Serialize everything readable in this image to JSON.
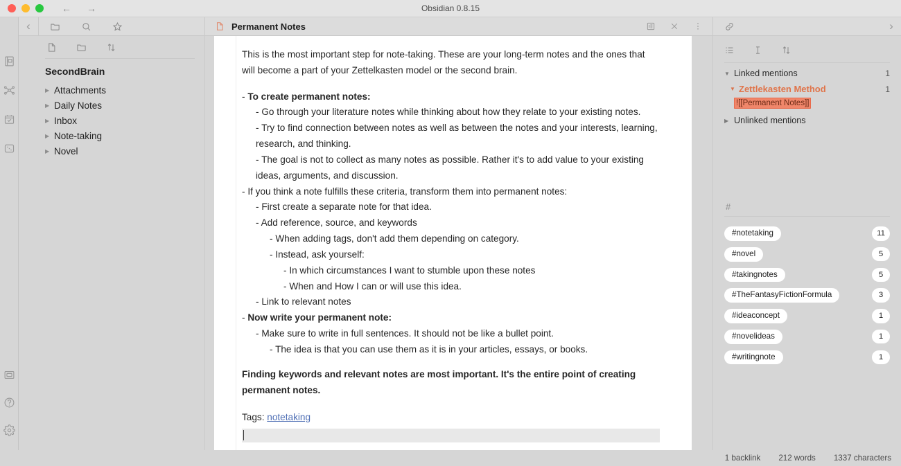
{
  "window": {
    "title": "Obsidian 0.8.15",
    "traffic_lights": [
      "close",
      "minimize",
      "maximize"
    ],
    "back_arrow": "←",
    "forward_arrow": "→"
  },
  "ribbon": {
    "items": [
      {
        "name": "open-vault-icon",
        "label": "Open vault"
      },
      {
        "name": "graph-view-icon",
        "label": "Open graph view"
      },
      {
        "name": "daily-note-icon",
        "label": "Open today's daily note"
      },
      {
        "name": "random-note-icon",
        "label": "Open random note"
      }
    ],
    "bottom_items": [
      {
        "name": "slides-icon",
        "label": "Start presentation"
      },
      {
        "name": "help-icon",
        "label": "Help"
      },
      {
        "name": "settings-icon",
        "label": "Settings"
      }
    ]
  },
  "left_sidebar": {
    "collapse_label": "‹",
    "tabs": [
      {
        "name": "file-explorer-tab",
        "icon": "folder-icon"
      },
      {
        "name": "search-tab",
        "icon": "search-icon"
      },
      {
        "name": "starred-tab",
        "icon": "star-icon"
      }
    ],
    "toolbar": [
      {
        "name": "new-note-button",
        "icon": "new-note-icon"
      },
      {
        "name": "new-folder-button",
        "icon": "new-folder-icon"
      },
      {
        "name": "change-sort-order-button",
        "icon": "sort-icon"
      }
    ],
    "vault_name": "SecondBrain",
    "tree": [
      {
        "label": "Attachments",
        "expanded": false
      },
      {
        "label": "Daily Notes",
        "expanded": false
      },
      {
        "label": "Inbox",
        "expanded": false
      },
      {
        "label": "Note-taking",
        "expanded": false
      },
      {
        "label": "Novel",
        "expanded": false
      }
    ],
    "collapsed_triangle": "▶"
  },
  "center": {
    "tab_icon": "document-icon",
    "title": "Permanent Notes",
    "actions": [
      {
        "name": "reading-view-button",
        "icon": "reading-view-icon"
      },
      {
        "name": "close-pane-button",
        "icon": "close-icon"
      },
      {
        "name": "more-options-button",
        "icon": "vertical-dots-icon"
      }
    ],
    "note": {
      "intro": "This is the most important step for note-taking. These are your long-term notes and the ones that will become a part of your Zettelkasten model or the second brain.",
      "lines": [
        {
          "level": 0,
          "dash": "-",
          "text": "To create permanent notes:",
          "bold": true
        },
        {
          "level": 1,
          "dash": "-",
          "text": "Go through your literature notes while thinking about how they relate to your existing notes.",
          "bold": false
        },
        {
          "level": 1,
          "dash": "-",
          "text": "Try to find connection between notes as well as between the notes and your interests, learning, research, and thinking.",
          "bold": false
        },
        {
          "level": 1,
          "dash": "-",
          "text": "The goal is not to collect as many notes as possible. Rather it's to add value to your existing ideas, arguments, and discussion.",
          "bold": false
        },
        {
          "level": 0,
          "dash": "-",
          "text": "If you think a note fulfills these criteria, transform them into permanent notes:",
          "bold": false
        },
        {
          "level": 1,
          "dash": "-",
          "text": "First create a separate note for that idea.",
          "bold": false
        },
        {
          "level": 1,
          "dash": "-",
          "text": "Add reference, source, and keywords",
          "bold": false
        },
        {
          "level": 2,
          "dash": "-",
          "text": "When adding tags, don't add them depending on category.",
          "bold": false
        },
        {
          "level": 2,
          "dash": "-",
          "text": "Instead, ask yourself:",
          "bold": false
        },
        {
          "level": 3,
          "dash": "-",
          "text": "In which circumstances I want to stumble upon these notes",
          "bold": false
        },
        {
          "level": 3,
          "dash": "-",
          "text": "When and How I can or will use this idea.",
          "bold": false
        },
        {
          "level": 1,
          "dash": "-",
          "text": "Link to relevant notes",
          "bold": false
        },
        {
          "level": 0,
          "dash": "-",
          "text": "Now write your permanent note:",
          "bold": true
        },
        {
          "level": 1,
          "dash": "-",
          "text": "Make sure to write in full sentences. It should not be like a bullet point.",
          "bold": false
        },
        {
          "level": 2,
          "dash": "-",
          "text": "The idea is that you can use them as it is in your articles, essays, or books.",
          "bold": false
        }
      ],
      "closing": "Finding keywords and relevant notes are most important. It's the entire point of creating permanent notes.",
      "tags_prefix": "Tags:",
      "tags_link": "notetaking"
    }
  },
  "right_sidebar": {
    "expand_label": "›",
    "tabs": [
      {
        "name": "backlinks-tab",
        "icon": "link-icon"
      }
    ],
    "backlinks_toolbar": [
      {
        "name": "collapse-results-button",
        "icon": "collapse-list-icon"
      },
      {
        "name": "show-more-context-button",
        "icon": "text-cursor-icon"
      },
      {
        "name": "change-sort-order-button",
        "icon": "sort-icon"
      }
    ],
    "linked_mentions": {
      "label": "Linked mentions",
      "count": "1",
      "expanded_triangle": "▼",
      "results": [
        {
          "file": "Zettlekasten Method",
          "count": "1",
          "excerpts": [
            "![[Permanent Notes]]"
          ]
        }
      ]
    },
    "unlinked_mentions": {
      "label": "Unlinked mentions",
      "collapsed_triangle": "▶"
    },
    "tags_pane": {
      "hash_icon": "#",
      "tags": [
        {
          "label": "#notetaking",
          "count": "11"
        },
        {
          "label": "#novel",
          "count": "5"
        },
        {
          "label": "#takingnotes",
          "count": "5"
        },
        {
          "label": "#TheFantasyFictionFormula",
          "count": "3"
        },
        {
          "label": "#ideaconcept",
          "count": "1"
        },
        {
          "label": "#novelideas",
          "count": "1"
        },
        {
          "label": "#writingnote",
          "count": "1"
        }
      ]
    }
  },
  "status_bar": {
    "backlinks": "1 backlink",
    "words": "212 words",
    "characters": "1337 characters"
  },
  "colors": {
    "accent_orange": "#e0744a",
    "highlight": "#f0866a",
    "doc_icon": "#e08a6e",
    "chrome": "#d6d6d6",
    "editor_bg": "#ffffff"
  }
}
